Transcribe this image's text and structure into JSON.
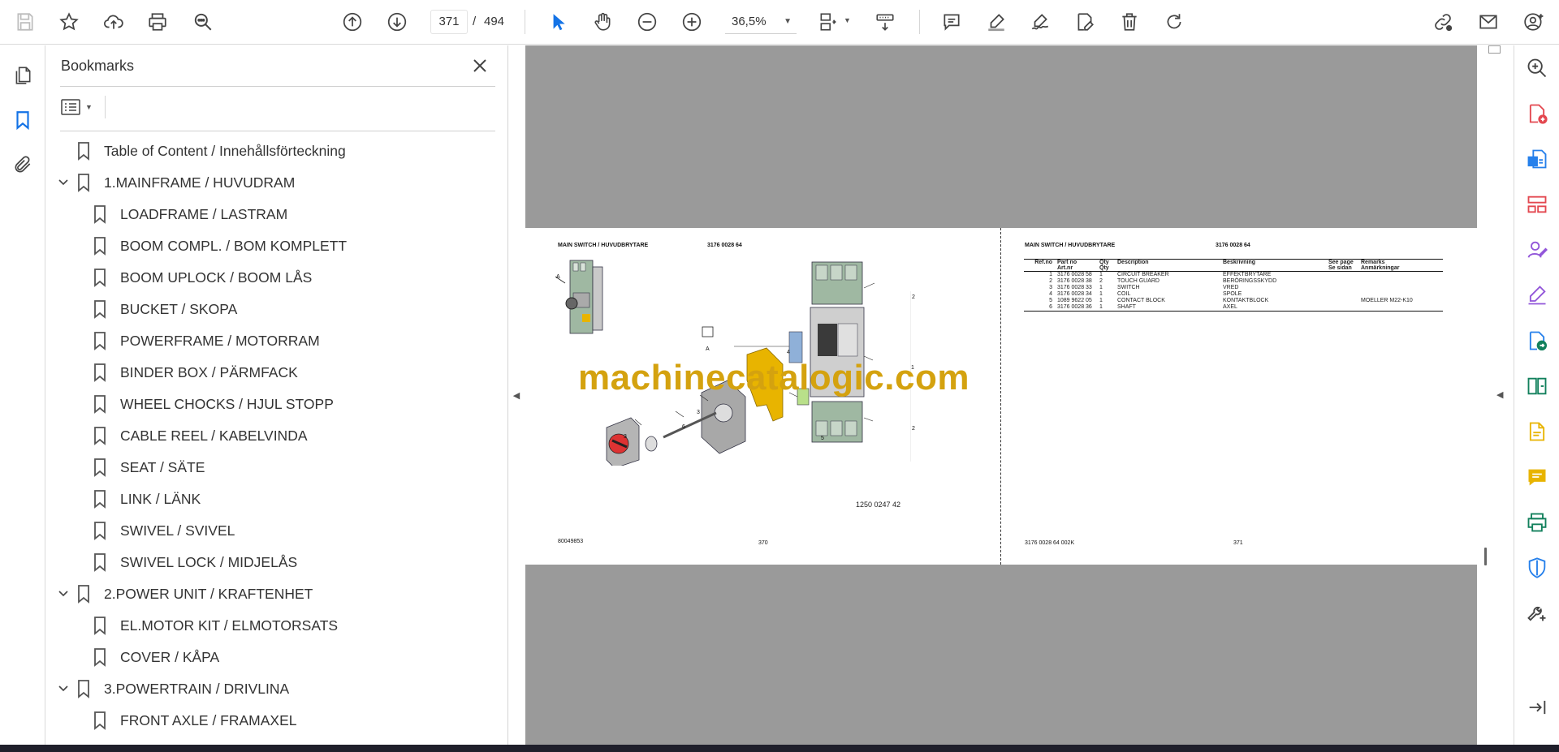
{
  "toolbar": {
    "current_page": "371",
    "page_separator": "/",
    "total_pages": "494",
    "zoom": "36,5%",
    "icons": [
      "save-icon",
      "star-icon",
      "upload-icon",
      "print-icon",
      "find-icon",
      "previous-page-icon",
      "next-page-icon",
      "zoom-out-icon",
      "zoom-in-icon",
      "select-cursor-icon",
      "hand-tool-icon",
      "fit-page-icon",
      "scroll-mode-icon",
      "comment-icon",
      "highlight-icon",
      "sign-icon",
      "fill-form-icon",
      "delete-icon",
      "rotate-icon",
      "share-link-icon",
      "email-icon",
      "account-icon"
    ]
  },
  "left_rail": {
    "icons": [
      "page-thumbnails-icon",
      "bookmarks-icon",
      "attachments-icon"
    ]
  },
  "bookmarks": {
    "title": "Bookmarks",
    "items": [
      {
        "label": "Table of Content / Innehållsförteckning",
        "level": 0,
        "expandable": false
      },
      {
        "label": "1.MAINFRAME / HUVUDRAM",
        "level": 0,
        "expandable": true
      },
      {
        "label": "LOADFRAME / LASTRAM",
        "level": 1,
        "expandable": false
      },
      {
        "label": "BOOM COMPL. / BOM KOMPLETT",
        "level": 1,
        "expandable": false
      },
      {
        "label": "BOOM UPLOCK / BOOM LÅS",
        "level": 1,
        "expandable": false
      },
      {
        "label": "BUCKET / SKOPA",
        "level": 1,
        "expandable": false
      },
      {
        "label": "POWERFRAME / MOTORRAM",
        "level": 1,
        "expandable": false
      },
      {
        "label": "BINDER BOX / PÄRMFACK",
        "level": 1,
        "expandable": false
      },
      {
        "label": "WHEEL CHOCKS / HJUL STOPP",
        "level": 1,
        "expandable": false
      },
      {
        "label": "CABLE REEL / KABELVINDA",
        "level": 1,
        "expandable": false
      },
      {
        "label": "SEAT / SÄTE",
        "level": 1,
        "expandable": false
      },
      {
        "label": "LINK / LÄNK",
        "level": 1,
        "expandable": false
      },
      {
        "label": "SWIVEL / SVIVEL",
        "level": 1,
        "expandable": false
      },
      {
        "label": "SWIVEL LOCK / MIDJELÅS",
        "level": 1,
        "expandable": false
      },
      {
        "label": "2.POWER UNIT / KRAFTENHET",
        "level": 0,
        "expandable": true
      },
      {
        "label": "EL.MOTOR KIT / ELMOTORSATS",
        "level": 1,
        "expandable": false
      },
      {
        "label": "COVER / KÅPA",
        "level": 1,
        "expandable": false
      },
      {
        "label": "3.POWERTRAIN / DRIVLINA",
        "level": 0,
        "expandable": true
      },
      {
        "label": "FRONT AXLE / FRAMAXEL",
        "level": 1,
        "expandable": false
      }
    ]
  },
  "document": {
    "left_page": {
      "title": "MAIN SWITCH / HUVUDBRYTARE",
      "part_number": "3176 0028 64",
      "drawing_number": "1250 0247 42",
      "footer_left": "80049853",
      "page_number": "370",
      "callouts": [
        "A",
        "A",
        "1",
        "2",
        "2",
        "3",
        "3",
        "4",
        "5",
        "6"
      ]
    },
    "right_page": {
      "title": "MAIN SWITCH / HUVUDBRYTARE",
      "part_number": "3176 0028 64",
      "footer_left": "3176 0028 64 002K",
      "page_number": "371",
      "table_headers": [
        [
          "Ref.no",
          ""
        ],
        [
          "Part no",
          "Art.nr"
        ],
        [
          "Qty",
          "Qty"
        ],
        [
          "Description",
          ""
        ],
        [
          "Beskrivning",
          ""
        ],
        [
          "See page",
          "Se sidan"
        ],
        [
          "Remarks",
          "Anmärkningar"
        ]
      ],
      "table_rows": [
        [
          "1",
          "3176 0028 58",
          "1",
          "CIRCUIT BREAKER",
          "EFFEKTBRYTARE",
          "",
          ""
        ],
        [
          "2",
          "3176 0028 38",
          "2",
          "TOUCH GUARD",
          "BERÖRINGSSKYDD",
          "",
          ""
        ],
        [
          "3",
          "3176 0028 33",
          "1",
          "SWITCH",
          "VRED",
          "",
          ""
        ],
        [
          "4",
          "3176 0028 34",
          "1",
          "COIL",
          "SPOLE",
          "",
          ""
        ],
        [
          "5",
          "1089 9622 05",
          "1",
          "CONTACT BLOCK",
          "KONTAKTBLOCK",
          "",
          "MOELLER M22-K10"
        ],
        [
          "6",
          "3176 0028 36",
          "1",
          "SHAFT",
          "AXEL",
          "",
          ""
        ]
      ]
    },
    "watermark": "machinecatalogic.com"
  },
  "right_rail": {
    "icons": [
      "zoom-tool-icon",
      "create-pdf-icon",
      "export-pdf-icon",
      "organize-pages-icon",
      "request-signature-icon",
      "fill-sign-icon",
      "convert-pdf-icon",
      "compare-files-icon",
      "edit-pdf-icon",
      "comment-tool-icon",
      "print-production-icon",
      "protect-icon",
      "more-tools-icon",
      "expand-panel-icon"
    ]
  },
  "colors": {
    "accent_blue": "#1473e6",
    "doc_background": "#9a9a9a",
    "watermark": "#d4a20f"
  }
}
